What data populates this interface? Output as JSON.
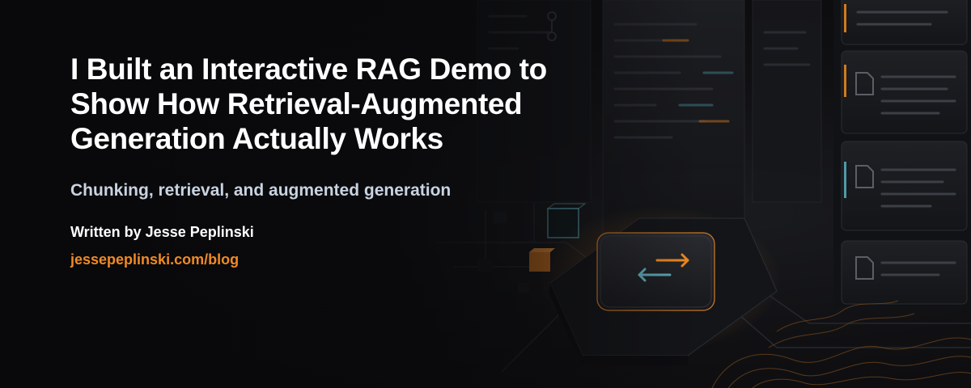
{
  "post": {
    "title_lines": [
      "I Built an Interactive RAG Demo to",
      "Show How Retrieval-Augmented",
      "Generation Actually Works"
    ],
    "subtitle": "Chunking, retrieval, and augmented generation",
    "byline": "Written by Jesse Peplinski",
    "link": "jessepeplinski.com/blog"
  },
  "colors": {
    "background": "#0c0c0f",
    "title": "#ffffff",
    "subtitle": "#c9d3e1",
    "accent_orange": "#f08a24",
    "accent_teal": "#5fa9b8"
  },
  "illustration": {
    "icons": [
      "server-rack-illustration",
      "swap-arrows-icon",
      "document-icon",
      "cube-icon",
      "circuit-lines"
    ]
  }
}
